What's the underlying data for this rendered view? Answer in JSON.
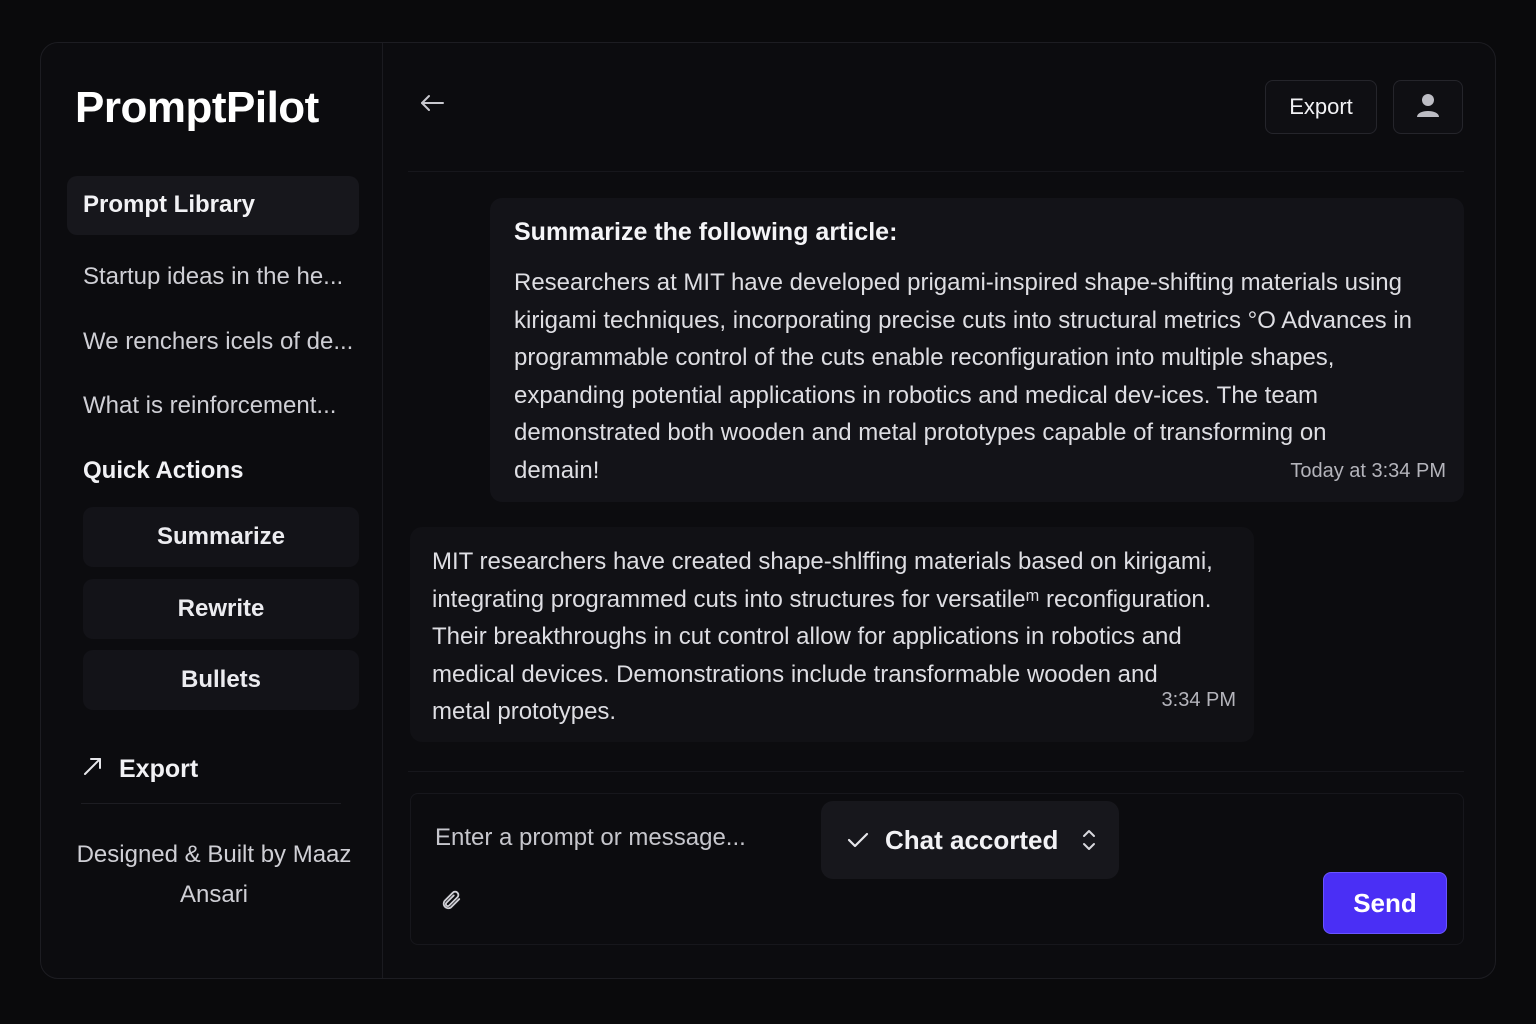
{
  "sidebar": {
    "app_name": "PromptPilot",
    "active_section": "Prompt Library",
    "history": [
      "Startup ideas in the he...",
      "We renchers icels of de...",
      "What is reinforcement..."
    ],
    "quick_actions_title": "Quick Actions",
    "quick_actions": [
      "Summarize",
      "Rewrite",
      "Bullets"
    ],
    "export_label": "Export",
    "credit": "Designed & Built by Maaz Ansari"
  },
  "header": {
    "export_label": "Export"
  },
  "messages": {
    "user": {
      "title": "Summarize the following article:",
      "body": "Researchers at MIT have developed prigami-inspired shape-shifting materials using kirigami techniques, incorporating precise cuts into structural metrics °O Advances in programmable control of the cuts enable reconfiguration into multiple shapes, expanding potential applications in robotics and medical dev-ices. The team demonstrated both wooden and metal prototypes capable of transforming on demain!",
      "time": "Today at 3:34 PM"
    },
    "assistant": {
      "body": "MIT researchers have created shape-shlffing materials based on kirigami, integrating programmed cuts into structures for versatileᵐ reconfiguration. Their breakthroughs in cut control allow for applications in robotics and medical devices. Demonstrations include transformable wooden and metal prototypes.",
      "time": "3:34 PM"
    }
  },
  "composer": {
    "placeholder": "Enter a prompt or message...",
    "mode_label": "Chat accorted",
    "send_label": "Send"
  },
  "colors": {
    "accent": "#4a2ff5",
    "background": "#0a0a0c"
  }
}
